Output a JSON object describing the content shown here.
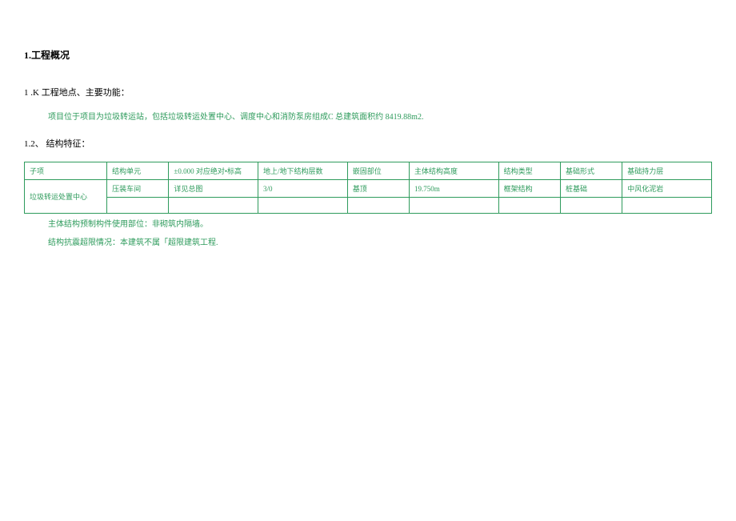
{
  "heading1": "1.工程概况",
  "heading2": "1 .K 工程地点、主要功能：",
  "description": "项目位于项目为垃圾转运站，包括垃圾转运处置中心、调度中心和消防泵房组成C 总建筑面积约 8419.88m2.",
  "heading3": "1.2、 结构特征：",
  "table": {
    "headers": [
      "子项",
      "结构单元",
      "±0.000 对应绝对•标高",
      "地上/地下结构层数",
      "嵌固部位",
      "主体结构高度",
      "结构类型",
      "基础形式",
      "基础持力层"
    ],
    "row1": [
      "垃圾转运处置中心",
      "压装车间",
      "详见总图",
      "3/0",
      "基顶",
      "19.750m",
      "框架结构",
      "桩基础",
      "中风化泥岩"
    ],
    "row2": [
      "",
      "",
      "",
      "",
      "",
      "",
      "",
      ""
    ]
  },
  "note1": "主体结构预制构件使用部位：非砌筑内隔墙。",
  "note2": "结构抗震超限情况：本建筑不属「超限建筑工程."
}
